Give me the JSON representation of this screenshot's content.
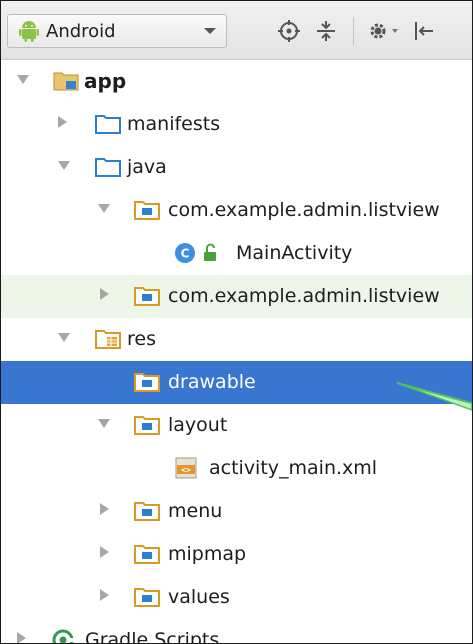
{
  "toolbar": {
    "view_selector": "Android",
    "icons": [
      "android-icon",
      "sync-icon",
      "collapse-all-icon",
      "gear-icon",
      "hide-panel-icon"
    ]
  },
  "tree": {
    "app": "app",
    "manifests": "manifests",
    "java": "java",
    "package_main": "com.example.admin.listview",
    "main_activity": "MainActivity",
    "package_test": "com.example.admin.listview",
    "res": "res",
    "drawable": "drawable",
    "layout": "layout",
    "activity_main": "activity_main.xml",
    "menu": "menu",
    "mipmap": "mipmap",
    "values": "values",
    "gradle_scripts": "Gradle Scripts"
  },
  "colors": {
    "selection": "#3876cf",
    "alt_row": "#eef6e9",
    "callout_line": "#4fc25a",
    "folder_blue": "#2b7fd3",
    "folder_gold": "#d79a27"
  }
}
